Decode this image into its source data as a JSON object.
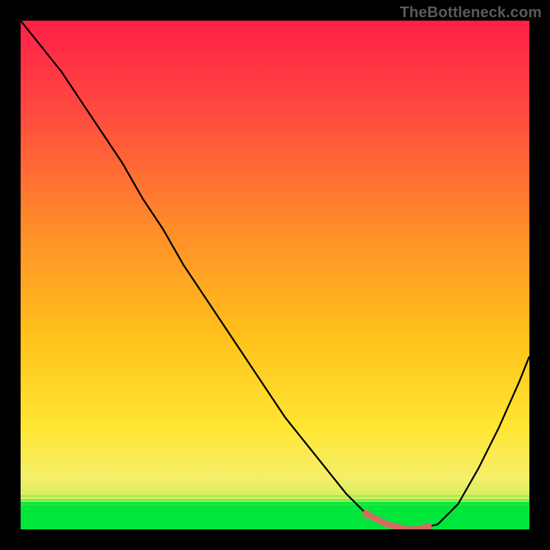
{
  "watermark": "TheBottleneck.com",
  "chart_data": {
    "type": "line",
    "title": "",
    "xlabel": "",
    "ylabel": "",
    "xlim": [
      0,
      100
    ],
    "ylim": [
      0,
      100
    ],
    "grid": false,
    "series": [
      {
        "name": "curve",
        "x": [
          0,
          4,
          8,
          12,
          16,
          20,
          24,
          28,
          32,
          36,
          40,
          44,
          48,
          52,
          56,
          60,
          64,
          68,
          72,
          76,
          78,
          82,
          86,
          90,
          94,
          98,
          100
        ],
        "values": [
          100,
          95,
          90,
          84,
          78,
          72,
          65,
          59,
          52,
          46,
          40,
          34,
          28,
          22,
          17,
          12,
          7,
          3,
          1,
          0,
          0,
          1,
          5,
          12,
          20,
          29,
          34
        ]
      }
    ],
    "highlight_band": {
      "x_start": 68,
      "x_end": 80,
      "color": "#d66a63"
    },
    "background_gradient": {
      "top": "#ff1f47",
      "mid": "#ffd400",
      "bottom": "#00e63a"
    }
  }
}
